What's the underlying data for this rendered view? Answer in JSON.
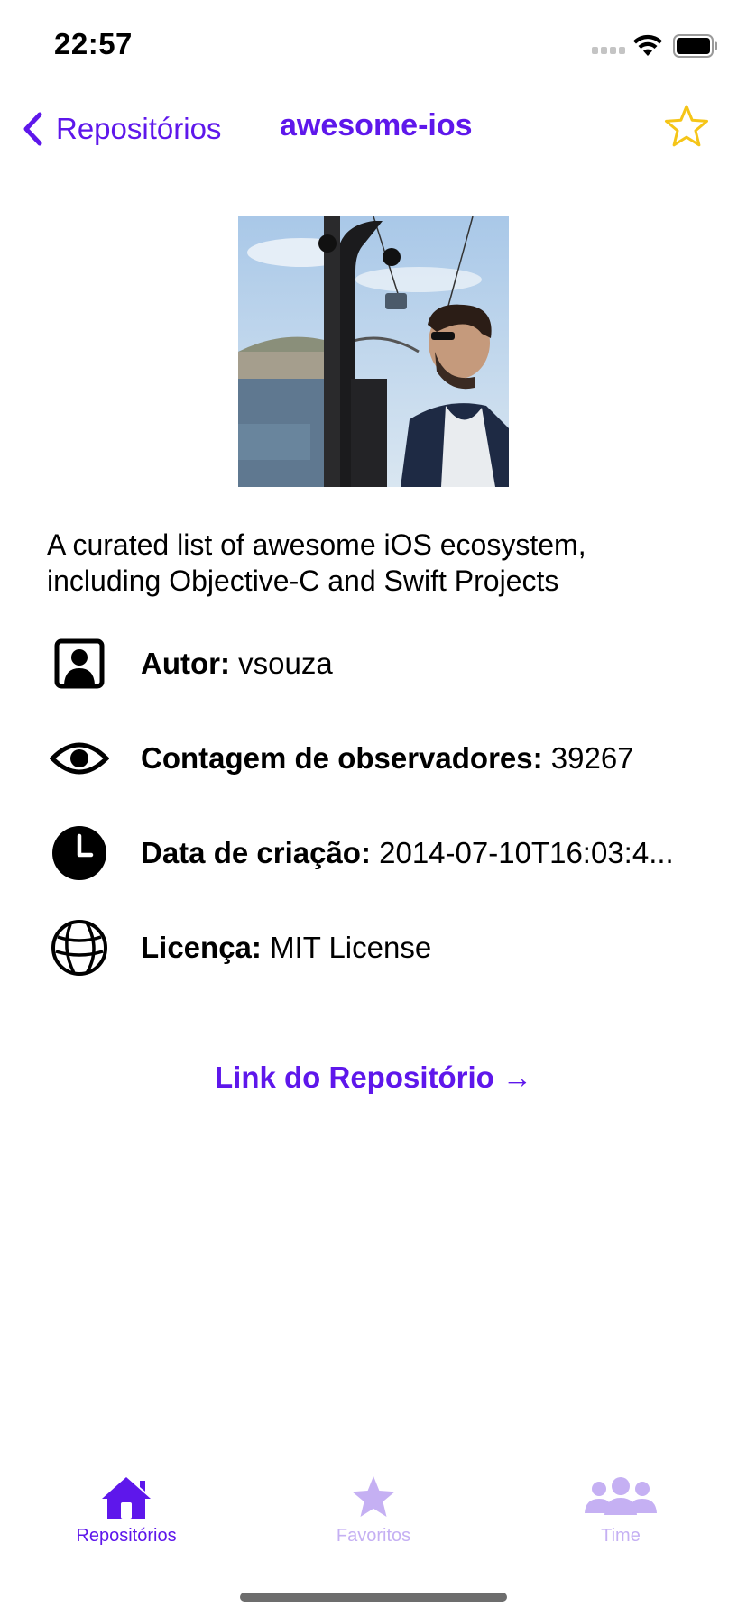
{
  "status_bar": {
    "time": "22:57"
  },
  "nav": {
    "back_label": "Repositórios",
    "title": "awesome-ios",
    "favorite_icon": "star-outline-icon"
  },
  "repo": {
    "description": "A curated list of awesome iOS ecosystem, including Objective-C and Swift Projects",
    "avatar_icon": "owner-avatar-photo",
    "info": [
      {
        "icon": "person-icon",
        "key": "Autor:",
        "value": "vsouza"
      },
      {
        "icon": "eye-icon",
        "key": "Contagem de observadores:",
        "value": "39267"
      },
      {
        "icon": "clock-icon",
        "key": "Data de criação:",
        "value": "2014-07-10T16:03:4..."
      },
      {
        "icon": "globe-icon",
        "key": "Licença:",
        "value": "MIT License"
      }
    ],
    "link_label": "Link do Repositório →"
  },
  "tabs": [
    {
      "label": "Repositórios",
      "icon": "house-icon",
      "active": true
    },
    {
      "label": "Favoritos",
      "icon": "star-icon",
      "active": false
    },
    {
      "label": "Time",
      "icon": "people-icon",
      "active": false
    }
  ],
  "colors": {
    "accent": "#5e17eb",
    "accent_inactive": "#c5b0f3",
    "star": "#f5c518"
  }
}
